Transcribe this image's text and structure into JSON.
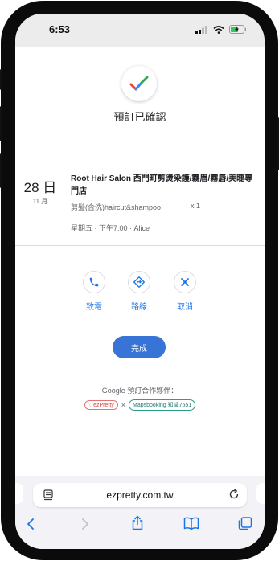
{
  "status_bar": {
    "time": "6:53"
  },
  "confirmation": {
    "title": "預訂已確認"
  },
  "booking": {
    "day": "28 日",
    "month": "11 月",
    "salon_name": "Root Hair Salon 西門町剪燙染護/霧眉/霧唇/美睫專門店",
    "service": "剪髮(含洗)haircut&shampoo",
    "quantity": "x 1",
    "time": "星期五 · 下午7:00 · Alice"
  },
  "actions": [
    {
      "label": "致電",
      "icon": "phone-icon"
    },
    {
      "label": "路線",
      "icon": "directions-icon"
    },
    {
      "label": "取消",
      "icon": "close-icon"
    }
  ],
  "done_button": "完成",
  "partners": {
    "label": "Google 預訂合作夥伴：",
    "ezpretty": "♡ezPretty",
    "separator": "×",
    "maps": "Mapsbooking 知識7551"
  },
  "browser": {
    "url": "ezpretty.com.tw"
  },
  "colors": {
    "accent": "#1a73e8",
    "button": "#3873d6"
  }
}
